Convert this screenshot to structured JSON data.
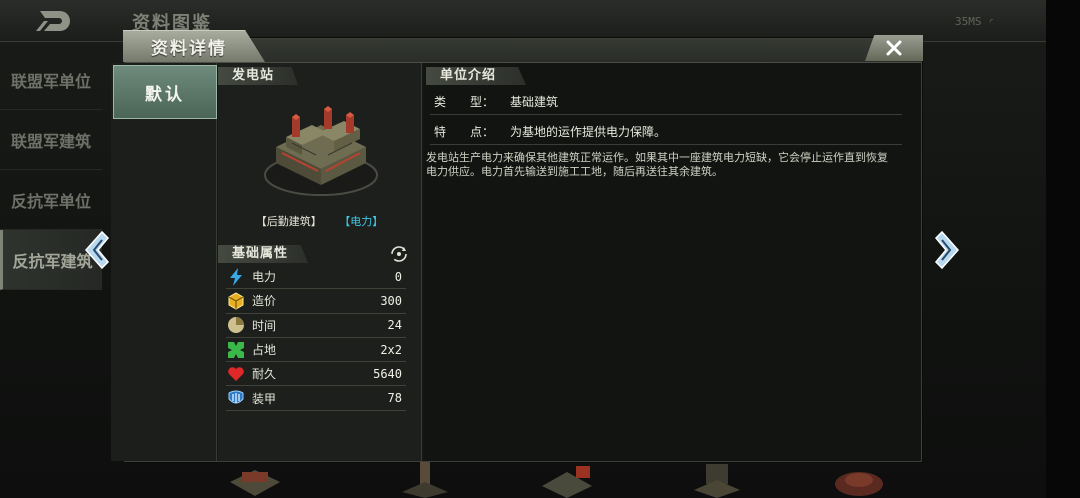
{
  "app": {
    "background_title": "资料图鉴",
    "ping": "35MS"
  },
  "background_sidebar": {
    "items": [
      {
        "label": "联盟军单位"
      },
      {
        "label": "联盟军建筑"
      },
      {
        "label": "反抗军单位"
      },
      {
        "label": "反抗军建筑"
      }
    ],
    "active_index": 3
  },
  "dialog": {
    "title": "资料详情",
    "close_icon": "close-icon",
    "tabs": [
      {
        "label": "默认"
      }
    ]
  },
  "unit": {
    "section_label": "发电站",
    "tag_category": "【后勤建筑】",
    "tag_type": "【电力】",
    "tag_type_color": "#3fc7e8",
    "attributes_label": "基础属性",
    "attributes": [
      {
        "icon": "lightning-icon",
        "label": "电力",
        "value": "0"
      },
      {
        "icon": "cube-icon",
        "label": "造价",
        "value": "300"
      },
      {
        "icon": "clock-icon",
        "label": "时间",
        "value": "24"
      },
      {
        "icon": "footprint-icon",
        "label": "占地",
        "value": "2x2"
      },
      {
        "icon": "heart-icon",
        "label": "耐久",
        "value": "5640"
      },
      {
        "icon": "armor-icon",
        "label": "装甲",
        "value": "78"
      }
    ]
  },
  "info": {
    "section_label": "单位介绍",
    "type_key": "类　　型：",
    "type_value": "基础建筑",
    "feature_key": "特　　点：",
    "feature_value": "为基地的运作提供电力保障。",
    "description": "发电站生产电力来确保其他建筑正常运作。如果其中一座建筑电力短缺，它会停止运作直到恢复电力供应。电力首先输送到施工工地，随后再送往其余建筑。"
  }
}
